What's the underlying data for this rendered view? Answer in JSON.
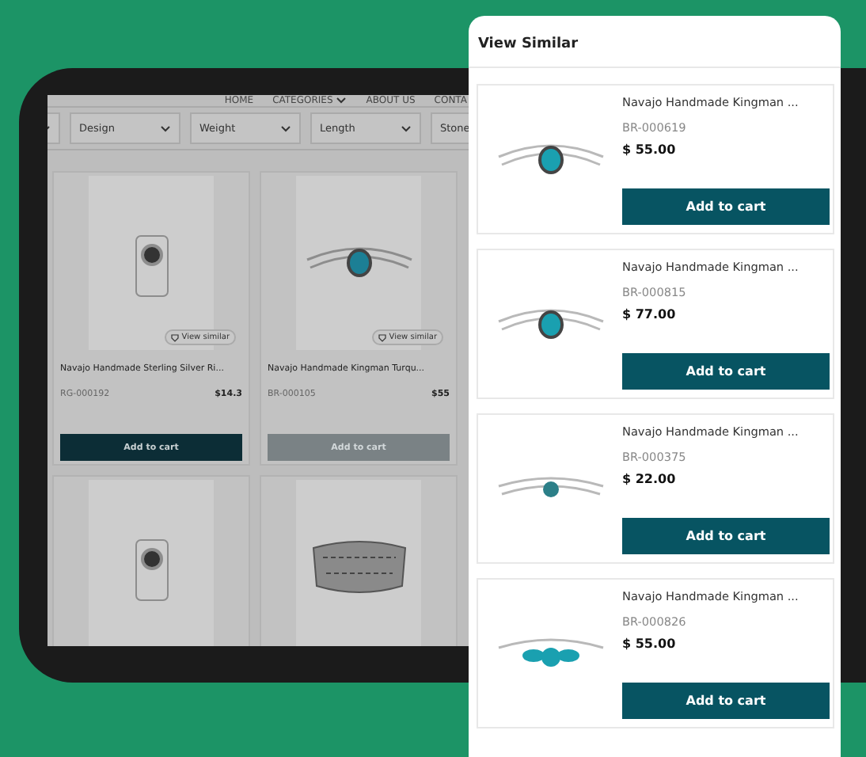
{
  "nav": [
    {
      "label": "HOME",
      "dropdown": false
    },
    {
      "label": "CATEGORIES",
      "dropdown": true
    },
    {
      "label": "ABOUT US",
      "dropdown": false
    },
    {
      "label": "CONTA",
      "dropdown": false
    }
  ],
  "filters": [
    {
      "label": "Design"
    },
    {
      "label": "Weight"
    },
    {
      "label": "Length"
    },
    {
      "label": "Stone"
    }
  ],
  "products": [
    {
      "kind": "ring",
      "view_similar": "View similar",
      "title": "Navajo Handmade Sterling Silver Ri...",
      "code": "RG-000192",
      "price": "$14.3",
      "button": "Add to cart",
      "disabled": false
    },
    {
      "kind": "bracelet",
      "view_similar": "View similar",
      "title": "Navajo Handmade Kingman Turqu...",
      "code": "BR-000105",
      "price": "$55",
      "button": "Add to cart",
      "disabled": true
    },
    {
      "kind": "ring"
    },
    {
      "kind": "cuff"
    }
  ],
  "panel": {
    "title": "View Similar",
    "items": [
      {
        "kind": "oval",
        "title": "Navajo Handmade Kingman ...",
        "code": "BR-000619",
        "price": "$ 55.00",
        "button": "Add to cart"
      },
      {
        "kind": "oval",
        "title": "Navajo Handmade Kingman ...",
        "code": "BR-000815",
        "price": "$ 77.00",
        "button": "Add to cart"
      },
      {
        "kind": "small",
        "title": "Navajo Handmade Kingman ...",
        "code": "BR-000375",
        "price": "$ 22.00",
        "button": "Add to cart"
      },
      {
        "kind": "triple",
        "title": "Navajo Handmade Kingman ...",
        "code": "BR-000826",
        "price": "$ 55.00",
        "button": "Add to cart"
      }
    ]
  }
}
